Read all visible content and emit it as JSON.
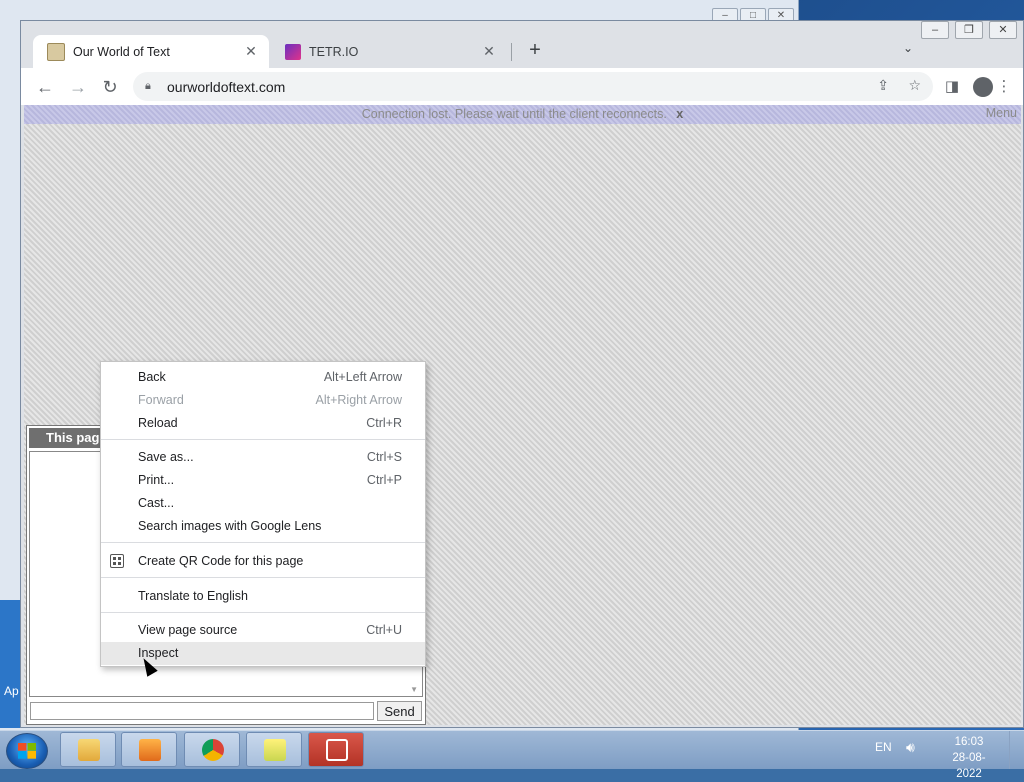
{
  "browser": {
    "tabs": [
      {
        "title": "Our World of Text",
        "active": true
      },
      {
        "title": "TETR.IO",
        "active": false
      }
    ],
    "new_tab_symbol": "+",
    "tab_close_symbol": "✕",
    "tab_search_symbol": "⌄",
    "url": "ourworldoftext.com",
    "icons": [
      "back-icon",
      "forward-icon",
      "reload-icon",
      "lock-icon",
      "share-icon",
      "star-icon",
      "side-panel-icon",
      "profile-icon",
      "kebab-menu-icon"
    ]
  },
  "page": {
    "banner_text": "Connection lost. Please wait until the client reconnects.",
    "banner_close": "x",
    "menu_label": "Menu",
    "chat": {
      "header": "This pag",
      "send_label": "Send"
    }
  },
  "context_menu": {
    "items": [
      {
        "label": "Back",
        "shortcut": "Alt+Left Arrow",
        "disabled": false
      },
      {
        "label": "Forward",
        "shortcut": "Alt+Right Arrow",
        "disabled": true
      },
      {
        "label": "Reload",
        "shortcut": "Ctrl+R",
        "disabled": false
      },
      {
        "label": "Save as...",
        "shortcut": "Ctrl+S",
        "disabled": false
      },
      {
        "label": "Print...",
        "shortcut": "Ctrl+P",
        "disabled": false
      },
      {
        "label": "Cast...",
        "shortcut": "",
        "disabled": false
      },
      {
        "label": "Search images with Google Lens",
        "shortcut": "",
        "disabled": false
      },
      {
        "label": "Create QR Code for this page",
        "shortcut": "",
        "disabled": false
      },
      {
        "label": "Translate to English",
        "shortcut": "",
        "disabled": false
      },
      {
        "label": "View page source",
        "shortcut": "Ctrl+U",
        "disabled": false
      },
      {
        "label": "Inspect",
        "shortcut": "",
        "disabled": false,
        "hovered": true
      }
    ]
  },
  "desktop": {
    "partial_label": "Ap"
  },
  "taskbar": {
    "apps": [
      "file-explorer-icon",
      "media-player-icon",
      "chrome-icon",
      "sticky-notes-icon",
      "remote-desktop-icon"
    ],
    "language": "EN",
    "time": "16:03",
    "date": "28-08-2022"
  },
  "colors": {
    "banner_bg": "#c8c8e8",
    "tab_strip": "#dee1e6",
    "taskbar": "#8eaacd"
  }
}
